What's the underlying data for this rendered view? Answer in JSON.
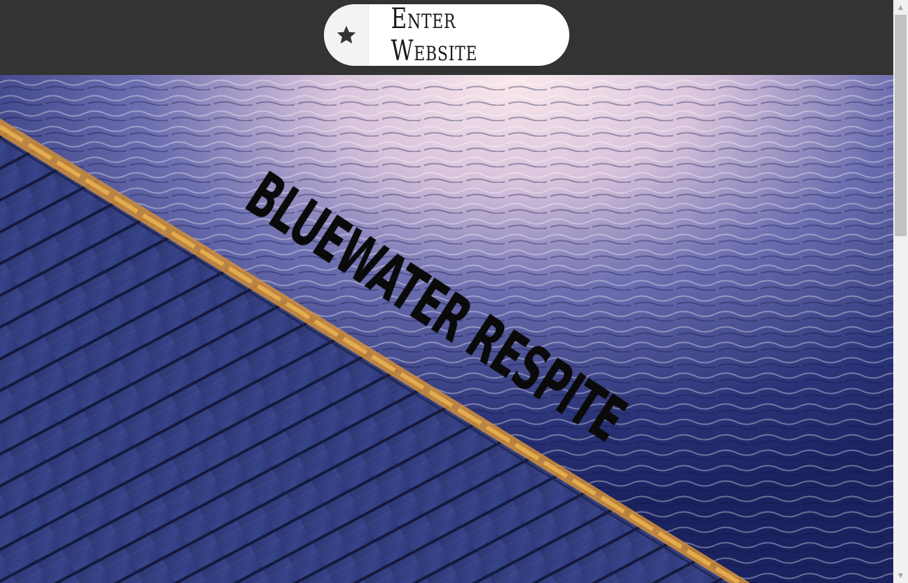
{
  "header": {
    "enter_button_label": "Enter Website",
    "enter_button_icon": "star-icon"
  },
  "hero": {
    "brand_text": "BLUEWATER RESPITE",
    "image_description_colors": {
      "water_dark": "#1f2a6b",
      "water_light": "#f3dde4",
      "dock_wood": "#2e3a78",
      "dock_edge": "#e6a23c"
    }
  },
  "colors": {
    "topbar": "#333333",
    "button_bg": "#ffffff",
    "star": "#333333"
  }
}
